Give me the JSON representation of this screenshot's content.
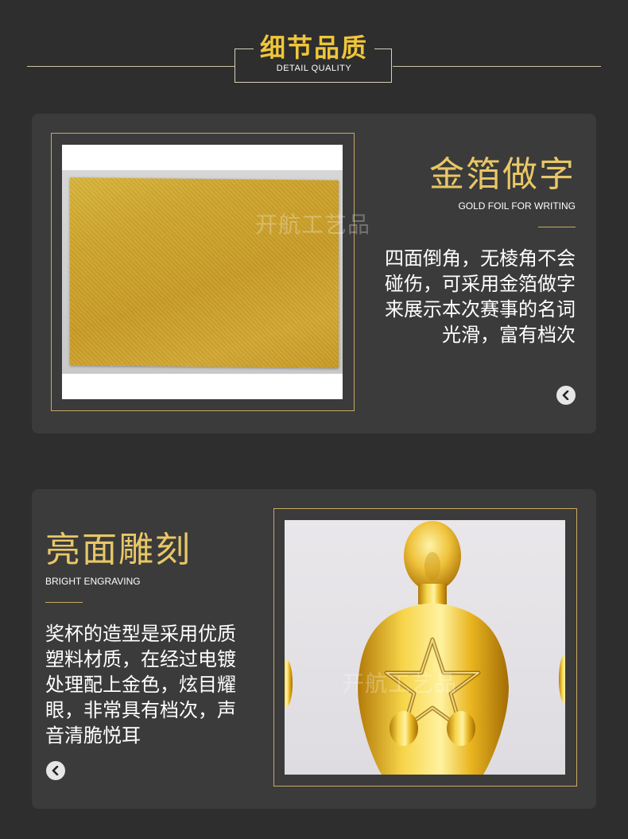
{
  "header": {
    "title": "细节品质",
    "subtitle": "DETAIL QUALITY"
  },
  "section1": {
    "title": "金箔做字",
    "subtitle": "GOLD FOIL FOR WRITING",
    "body_lines": [
      "四面倒角，无棱角不会",
      "碰伤，可采用金箔做字",
      "来展示本次赛事的名词",
      "光滑，富有档次"
    ],
    "watermark": "开航工艺品",
    "photo_icon": "gold-foil-sheet-photo",
    "arrow_icon": "chevron-left-icon"
  },
  "section2": {
    "title": "亮面雕刻",
    "subtitle": "BRIGHT ENGRAVING",
    "body_lines": [
      "奖杯的造型是采用优质",
      "塑料材质，在经过电镀",
      "处理配上金色，炫目耀",
      "眼，非常具有档次，声",
      "音清脆悦耳"
    ],
    "watermark": "开航工艺品",
    "photo_icon": "gold-trophy-statue-photo",
    "arrow_icon": "chevron-left-icon"
  },
  "colors": {
    "background": "#2e2e2e",
    "card": "#3b3b3b",
    "gold_title": "#e8c766",
    "header_gold": "#f0c63a",
    "frame": "#c8aa62"
  }
}
